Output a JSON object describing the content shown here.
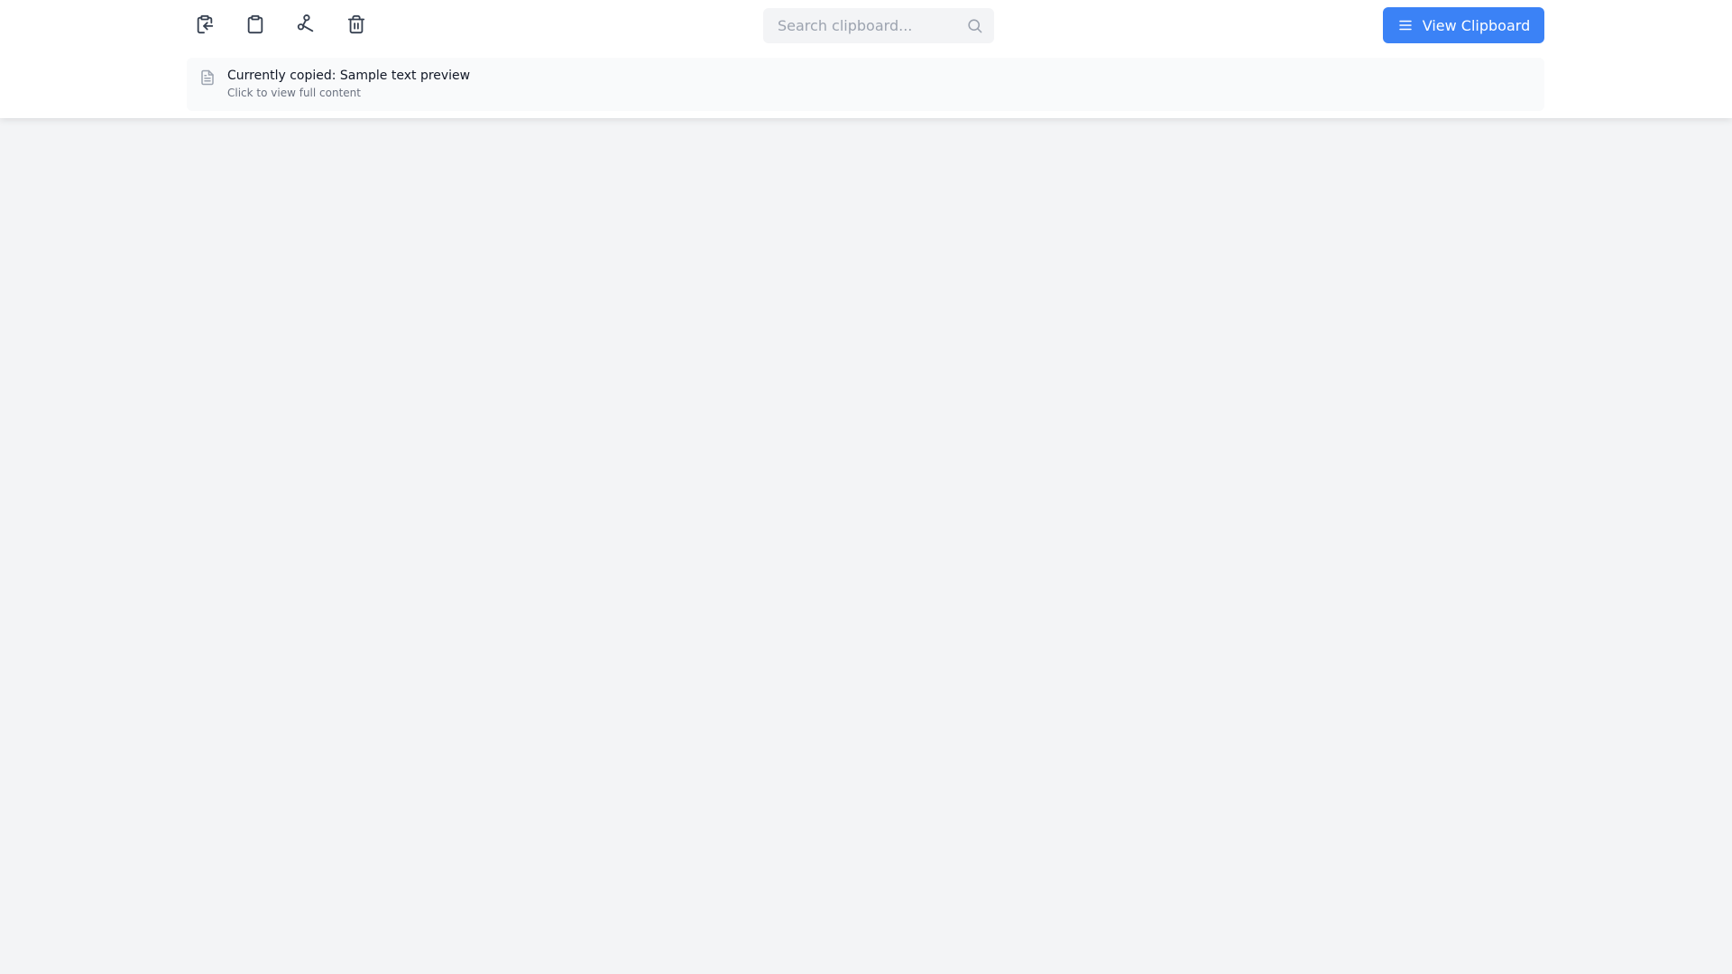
{
  "toolbar": {
    "icons": [
      {
        "name": "clipboard-paste-icon",
        "action": "paste"
      },
      {
        "name": "clipboard-icon",
        "action": "copy"
      },
      {
        "name": "scissors-icon",
        "action": "cut"
      },
      {
        "name": "trash-icon",
        "action": "clear"
      }
    ],
    "search": {
      "placeholder": "Search clipboard...",
      "value": ""
    },
    "view_button": {
      "label": "View Clipboard",
      "icon": "menu-icon"
    }
  },
  "preview": {
    "icon": "file-text-icon",
    "title": "Currently copied: Sample text preview",
    "subtitle": "Click to view full content"
  },
  "colors": {
    "accent": "#3b82f6",
    "background": "#f3f4f6",
    "panel": "#ffffff",
    "icon": "#374151",
    "muted": "#9ca3af"
  }
}
